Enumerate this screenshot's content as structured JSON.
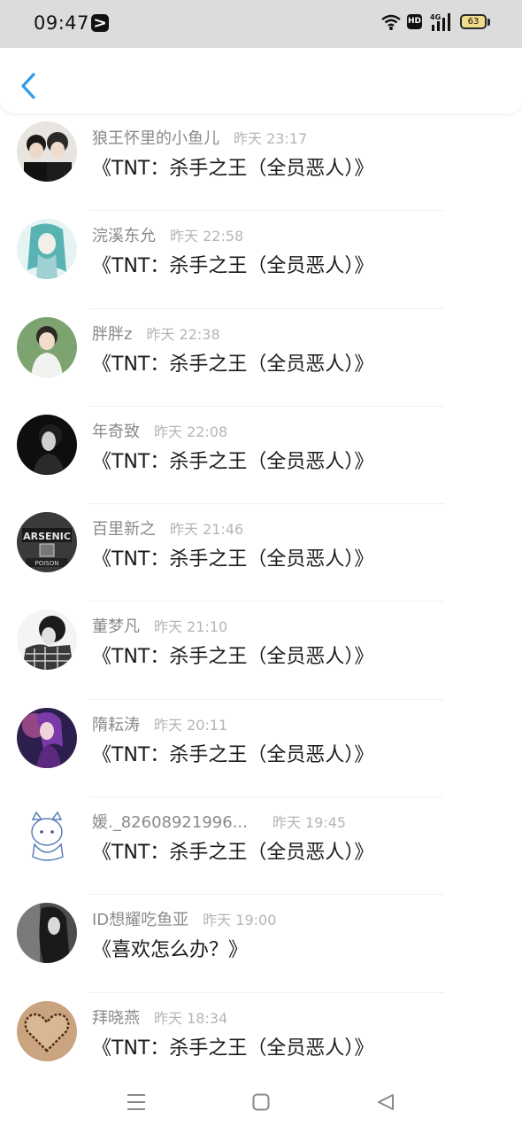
{
  "status_bar": {
    "time": "09:47",
    "network_label": "HD",
    "signal_label": "4G",
    "battery": "63"
  },
  "header": {
    "back_icon": "chevron-left-icon",
    "accent_color": "#2f9be8"
  },
  "messages": [
    {
      "name": "狼王怀里的小鱼儿",
      "time": "昨天 23:17",
      "title": "《TNT：杀手之王（全员恶人）》"
    },
    {
      "name": "浣溪东允",
      "time": "昨天 22:58",
      "title": "《TNT：杀手之王（全员恶人）》"
    },
    {
      "name": "胖胖z",
      "time": "昨天 22:38",
      "title": "《TNT：杀手之王（全员恶人）》"
    },
    {
      "name": "年奇致",
      "time": "昨天 22:08",
      "title": "《TNT：杀手之王（全员恶人）》"
    },
    {
      "name": "百里新之",
      "time": "昨天 21:46",
      "title": "《TNT：杀手之王（全员恶人）》"
    },
    {
      "name": "董梦凡",
      "time": "昨天 21:10",
      "title": "《TNT：杀手之王（全员恶人）》"
    },
    {
      "name": "隋耘涛",
      "time": "昨天 20:11",
      "title": "《TNT：杀手之王（全员恶人）》"
    },
    {
      "name": "媛._82608921996...",
      "time": "昨天 19:45",
      "title": "《TNT：杀手之王（全员恶人）》"
    },
    {
      "name": "ID想耀吃鱼亚",
      "time": "昨天 19:00",
      "title": "《喜欢怎么办？》"
    },
    {
      "name": "拜晓燕",
      "time": "昨天 18:34",
      "title": "《TNT：杀手之王（全员恶人）》"
    }
  ],
  "nav_bar": {
    "menu_icon": "menu-icon",
    "home_icon": "home-square-icon",
    "back_icon": "back-triangle-icon"
  }
}
